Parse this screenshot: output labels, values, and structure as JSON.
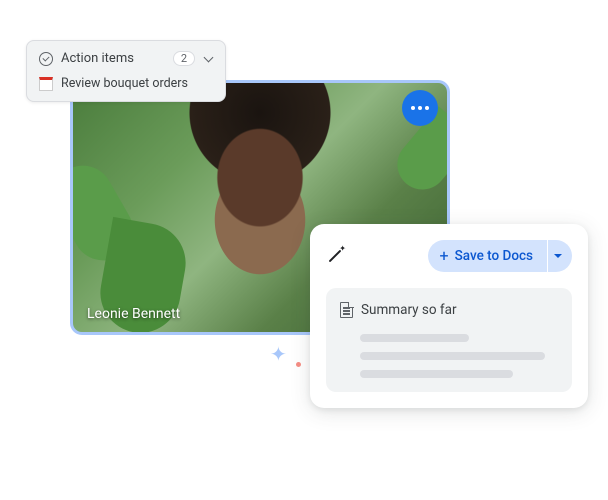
{
  "video": {
    "participant_name": "Leonie Bennett"
  },
  "action_items": {
    "title": "Action items",
    "count": "2",
    "items": [
      {
        "text": "Review bouquet orders"
      }
    ]
  },
  "summary": {
    "save_label": "Save to Docs",
    "title": "Summary so far"
  }
}
